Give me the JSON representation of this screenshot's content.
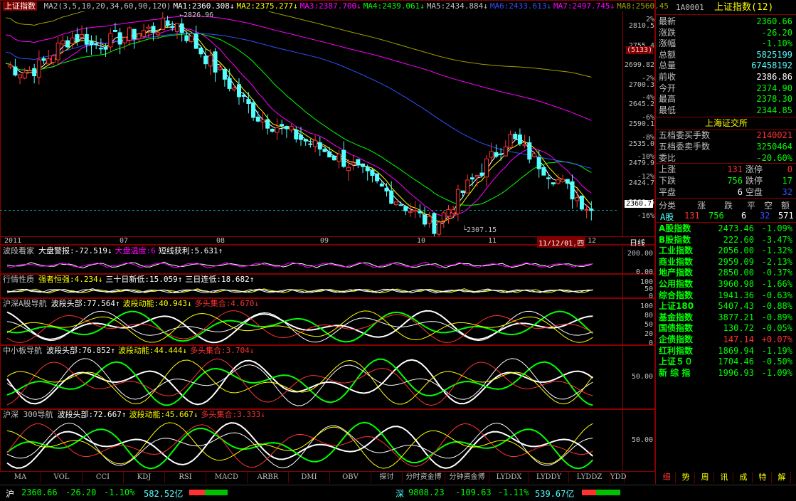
{
  "colors": {
    "up": "#ff3232",
    "down": "#54ffff",
    "green": "#00ff00",
    "yellow": "#ffff00",
    "white": "#ffffff",
    "magenta": "#ff00ff",
    "blue": "#3050ff",
    "olive": "#a0a000",
    "grid": "#8a0000",
    "label": "#c0c0c0"
  },
  "main": {
    "title": "上证指数",
    "ma_labels": [
      {
        "t": "MA2(3,5,10,20,34,60,90,120)",
        "c": "#c0c0c0"
      },
      {
        "t": "MA1:2360.308↓",
        "c": "#ffffff"
      },
      {
        "t": "MA2:2375.277↓",
        "c": "#ffff00"
      },
      {
        "t": "MA3:2387.700↓",
        "c": "#ff00ff"
      },
      {
        "t": "MA4:2439.061↓",
        "c": "#00ff00"
      },
      {
        "t": "MA5:2434.884↓",
        "c": "#c0c0c0"
      },
      {
        "t": "MA6:2433.613↓",
        "c": "#3050ff"
      },
      {
        "t": "MA7:2497.745↓",
        "c": "#ff00ff"
      },
      {
        "t": "MA8:2560.45",
        "c": "#a0a000"
      }
    ],
    "high_label": "2826.96",
    "low_label": "2307.15",
    "price_ticks": [
      {
        "pct": "2%",
        "price": "2810.5"
      },
      {
        "pct": "",
        "price": "2755.4"
      },
      {
        "pct": "",
        "price": "2699.82"
      },
      {
        "pct": "-2%",
        "price": "2700.3"
      },
      {
        "pct": "-4%",
        "price": "2645.2"
      },
      {
        "pct": "-6%",
        "price": "2590.1"
      },
      {
        "pct": "-8%",
        "price": "2535.0"
      },
      {
        "pct": "-10%",
        "price": "2479.9"
      },
      {
        "pct": "-12%",
        "price": "2424.7"
      },
      {
        "pct": "",
        "price": "2369.6"
      },
      {
        "pct": "-16%",
        "price": ""
      }
    ],
    "current_price": "2360.7",
    "badge": "(5133)",
    "months": [
      "2011",
      "07",
      "08",
      "09",
      "10",
      "11",
      "12"
    ],
    "date_cursor": "11/12/01,四",
    "period": "日线"
  },
  "sub1": {
    "name": "波段看家",
    "items": [
      {
        "t": "大盘警报:-72.519↓",
        "c": "#ffffff"
      },
      {
        "t": "大盘温度:6",
        "c": "#ff00ff"
      },
      {
        "t": "短线获利:5.631↑",
        "c": "#ffffff"
      }
    ],
    "ticks": [
      "200.00",
      "0.00"
    ]
  },
  "sub2": {
    "name": "行情性质",
    "items": [
      {
        "t": "强者恒强:4.234↓",
        "c": "#ffff00"
      },
      {
        "t": "三十日新低:15.059↑",
        "c": "#ffffff"
      },
      {
        "t": "三日连低:18.682↑",
        "c": "#ffffff"
      }
    ],
    "ticks": [
      "100",
      "50",
      "0"
    ]
  },
  "sub3": {
    "name": "沪深A股导航",
    "items": [
      {
        "t": "波段头部:77.564↑",
        "c": "#ffffff"
      },
      {
        "t": "波段动能:40.943↓",
        "c": "#ffff00"
      },
      {
        "t": "多头集合:4.670↓",
        "c": "#ff3232"
      }
    ],
    "ticks": [
      "100",
      "80",
      "50",
      "20",
      "0"
    ]
  },
  "sub4": {
    "name": "中小板导航",
    "items": [
      {
        "t": "波段头部:76.852↑",
        "c": "#ffffff"
      },
      {
        "t": "波段动能:44.444↓",
        "c": "#ffff00"
      },
      {
        "t": "多头集合:3.704↓",
        "c": "#ff3232"
      }
    ],
    "ticks": [
      "50.00"
    ]
  },
  "sub5": {
    "name": "沪深 300导航",
    "items": [
      {
        "t": "波段头部:72.667↑",
        "c": "#ffffff"
      },
      {
        "t": "波段动能:45.667↓",
        "c": "#ffff00"
      },
      {
        "t": "多头集合:3.333↓",
        "c": "#ff3232"
      }
    ],
    "ticks": [
      "50.00"
    ]
  },
  "tabs": [
    "MA",
    "VOL",
    "CCI",
    "KDJ",
    "RSI",
    "MACD",
    "ARBR",
    "DMI",
    "OBV",
    "探讨",
    "分时资金博",
    "分钟资金博",
    "LYDDX",
    "LYDDY",
    "LYDDZ",
    "YDD"
  ],
  "right": {
    "code": "1A0001",
    "name": "上证指数(12)",
    "quote": [
      {
        "k": "最新",
        "v": "2360.66",
        "c": "#00ff00"
      },
      {
        "k": "涨跌",
        "v": "-26.20",
        "c": "#00ff00"
      },
      {
        "k": "涨幅",
        "v": "-1.10%",
        "c": "#00ff00"
      },
      {
        "k": "总额",
        "v": "5825199",
        "c": "#54ffff"
      },
      {
        "k": "总量",
        "v": "67458192",
        "c": "#54ffff"
      },
      {
        "k": "前收",
        "v": "2386.86",
        "c": "#ffffff"
      },
      {
        "k": "今开",
        "v": "2374.90",
        "c": "#00ff00"
      },
      {
        "k": "最高",
        "v": "2378.30",
        "c": "#00ff00"
      },
      {
        "k": "最低",
        "v": "2344.85",
        "c": "#00ff00"
      }
    ],
    "exchange": "上海证交所",
    "wudang": [
      {
        "k": "五档委买手数",
        "v": "2140021",
        "c": "#ff3232"
      },
      {
        "k": "五档委卖手数",
        "v": "3250464",
        "c": "#00ff00"
      },
      {
        "k": "委比",
        "v": "-20.60%",
        "c": "#00ff00"
      }
    ],
    "breadth": [
      {
        "k1": "上涨",
        "v1": "131",
        "c1": "#ff3232",
        "k2": "涨停",
        "v2": "0",
        "c2": "#ff3232"
      },
      {
        "k1": "下跌",
        "v1": "756",
        "c1": "#00ff00",
        "k2": "跌停",
        "v2": "17",
        "c2": "#00ff00"
      },
      {
        "k1": "平盘",
        "v1": "6",
        "c1": "#ffffff",
        "k2": "空盘",
        "v2": "32",
        "c2": "#3050ff"
      }
    ],
    "class_head": [
      "分类",
      "涨",
      "跌",
      "平",
      "空",
      "额"
    ],
    "class_row": {
      "name": "A股",
      "up": "131",
      "down": "756",
      "flat": "6",
      "empty": "32",
      "amount": "571"
    },
    "indices": [
      {
        "k": "A股指数",
        "v": "2473.46",
        "p": "-1.09%",
        "c": "#00ff00"
      },
      {
        "k": "B股指数",
        "v": "222.60",
        "p": "-3.47%",
        "c": "#00ff00"
      },
      {
        "k": "工业指数",
        "v": "2056.00",
        "p": "-1.32%",
        "c": "#00ff00"
      },
      {
        "k": "商业指数",
        "v": "2959.09",
        "p": "-2.13%",
        "c": "#00ff00"
      },
      {
        "k": "地产指数",
        "v": "2850.00",
        "p": "-0.37%",
        "c": "#00ff00"
      },
      {
        "k": "公用指数",
        "v": "3960.98",
        "p": "-1.66%",
        "c": "#00ff00"
      },
      {
        "k": "综合指数",
        "v": "1941.36",
        "p": "-0.63%",
        "c": "#00ff00"
      },
      {
        "k": "上证180",
        "v": "5407.43",
        "p": "-0.88%",
        "c": "#00ff00"
      },
      {
        "k": "基金指数",
        "v": "3877.21",
        "p": "-0.89%",
        "c": "#00ff00"
      },
      {
        "k": "国债指数",
        "v": "130.72",
        "p": "-0.05%",
        "c": "#00ff00"
      },
      {
        "k": "企债指数",
        "v": "147.14",
        "p": "+0.07%",
        "c": "#ff3232"
      },
      {
        "k": "红利指数",
        "v": "1869.94",
        "p": "-1.19%",
        "c": "#00ff00"
      },
      {
        "k": "上证５０",
        "v": "1704.46",
        "p": "-0.50%",
        "c": "#00ff00"
      },
      {
        "k": "新 综 指",
        "v": "1996.93",
        "p": "-1.09%",
        "c": "#00ff00"
      }
    ],
    "tabs": [
      "细",
      "势",
      "周",
      "讯",
      "成",
      "特",
      "解"
    ]
  },
  "status": {
    "sh_label": "沪",
    "sh_price": "2360.66",
    "sh_chg": "-26.20",
    "sh_pct": "-1.10%",
    "sh_amt": "582.52亿",
    "sz_label": "深",
    "sz_price": "9808.23",
    "sz_chg": "-109.63",
    "sz_pct": "-1.11%",
    "sz_amt": "539.67亿"
  }
}
